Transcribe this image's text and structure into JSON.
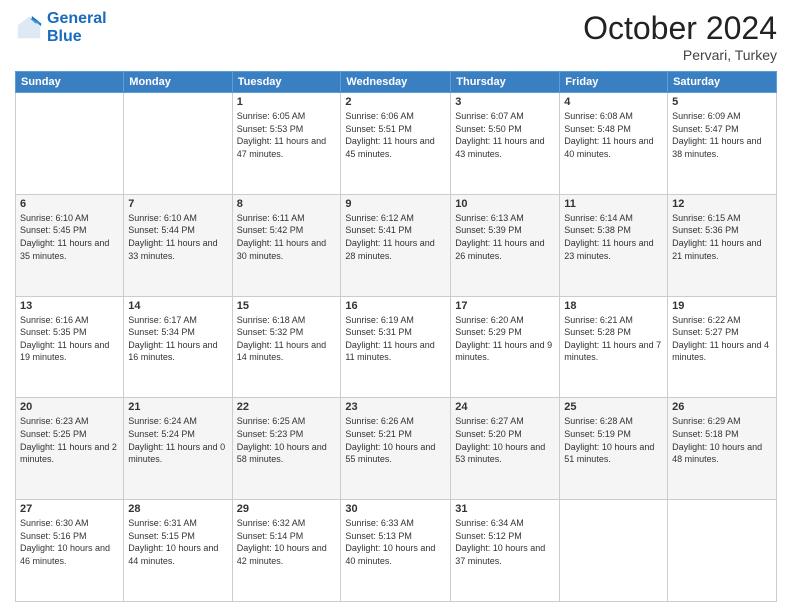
{
  "header": {
    "logo_line1": "General",
    "logo_line2": "Blue",
    "month": "October 2024",
    "location": "Pervari, Turkey"
  },
  "weekdays": [
    "Sunday",
    "Monday",
    "Tuesday",
    "Wednesday",
    "Thursday",
    "Friday",
    "Saturday"
  ],
  "weeks": [
    [
      {
        "day": "",
        "sunrise": "",
        "sunset": "",
        "daylight": ""
      },
      {
        "day": "",
        "sunrise": "",
        "sunset": "",
        "daylight": ""
      },
      {
        "day": "1",
        "sunrise": "Sunrise: 6:05 AM",
        "sunset": "Sunset: 5:53 PM",
        "daylight": "Daylight: 11 hours and 47 minutes."
      },
      {
        "day": "2",
        "sunrise": "Sunrise: 6:06 AM",
        "sunset": "Sunset: 5:51 PM",
        "daylight": "Daylight: 11 hours and 45 minutes."
      },
      {
        "day": "3",
        "sunrise": "Sunrise: 6:07 AM",
        "sunset": "Sunset: 5:50 PM",
        "daylight": "Daylight: 11 hours and 43 minutes."
      },
      {
        "day": "4",
        "sunrise": "Sunrise: 6:08 AM",
        "sunset": "Sunset: 5:48 PM",
        "daylight": "Daylight: 11 hours and 40 minutes."
      },
      {
        "day": "5",
        "sunrise": "Sunrise: 6:09 AM",
        "sunset": "Sunset: 5:47 PM",
        "daylight": "Daylight: 11 hours and 38 minutes."
      }
    ],
    [
      {
        "day": "6",
        "sunrise": "Sunrise: 6:10 AM",
        "sunset": "Sunset: 5:45 PM",
        "daylight": "Daylight: 11 hours and 35 minutes."
      },
      {
        "day": "7",
        "sunrise": "Sunrise: 6:10 AM",
        "sunset": "Sunset: 5:44 PM",
        "daylight": "Daylight: 11 hours and 33 minutes."
      },
      {
        "day": "8",
        "sunrise": "Sunrise: 6:11 AM",
        "sunset": "Sunset: 5:42 PM",
        "daylight": "Daylight: 11 hours and 30 minutes."
      },
      {
        "day": "9",
        "sunrise": "Sunrise: 6:12 AM",
        "sunset": "Sunset: 5:41 PM",
        "daylight": "Daylight: 11 hours and 28 minutes."
      },
      {
        "day": "10",
        "sunrise": "Sunrise: 6:13 AM",
        "sunset": "Sunset: 5:39 PM",
        "daylight": "Daylight: 11 hours and 26 minutes."
      },
      {
        "day": "11",
        "sunrise": "Sunrise: 6:14 AM",
        "sunset": "Sunset: 5:38 PM",
        "daylight": "Daylight: 11 hours and 23 minutes."
      },
      {
        "day": "12",
        "sunrise": "Sunrise: 6:15 AM",
        "sunset": "Sunset: 5:36 PM",
        "daylight": "Daylight: 11 hours and 21 minutes."
      }
    ],
    [
      {
        "day": "13",
        "sunrise": "Sunrise: 6:16 AM",
        "sunset": "Sunset: 5:35 PM",
        "daylight": "Daylight: 11 hours and 19 minutes."
      },
      {
        "day": "14",
        "sunrise": "Sunrise: 6:17 AM",
        "sunset": "Sunset: 5:34 PM",
        "daylight": "Daylight: 11 hours and 16 minutes."
      },
      {
        "day": "15",
        "sunrise": "Sunrise: 6:18 AM",
        "sunset": "Sunset: 5:32 PM",
        "daylight": "Daylight: 11 hours and 14 minutes."
      },
      {
        "day": "16",
        "sunrise": "Sunrise: 6:19 AM",
        "sunset": "Sunset: 5:31 PM",
        "daylight": "Daylight: 11 hours and 11 minutes."
      },
      {
        "day": "17",
        "sunrise": "Sunrise: 6:20 AM",
        "sunset": "Sunset: 5:29 PM",
        "daylight": "Daylight: 11 hours and 9 minutes."
      },
      {
        "day": "18",
        "sunrise": "Sunrise: 6:21 AM",
        "sunset": "Sunset: 5:28 PM",
        "daylight": "Daylight: 11 hours and 7 minutes."
      },
      {
        "day": "19",
        "sunrise": "Sunrise: 6:22 AM",
        "sunset": "Sunset: 5:27 PM",
        "daylight": "Daylight: 11 hours and 4 minutes."
      }
    ],
    [
      {
        "day": "20",
        "sunrise": "Sunrise: 6:23 AM",
        "sunset": "Sunset: 5:25 PM",
        "daylight": "Daylight: 11 hours and 2 minutes."
      },
      {
        "day": "21",
        "sunrise": "Sunrise: 6:24 AM",
        "sunset": "Sunset: 5:24 PM",
        "daylight": "Daylight: 11 hours and 0 minutes."
      },
      {
        "day": "22",
        "sunrise": "Sunrise: 6:25 AM",
        "sunset": "Sunset: 5:23 PM",
        "daylight": "Daylight: 10 hours and 58 minutes."
      },
      {
        "day": "23",
        "sunrise": "Sunrise: 6:26 AM",
        "sunset": "Sunset: 5:21 PM",
        "daylight": "Daylight: 10 hours and 55 minutes."
      },
      {
        "day": "24",
        "sunrise": "Sunrise: 6:27 AM",
        "sunset": "Sunset: 5:20 PM",
        "daylight": "Daylight: 10 hours and 53 minutes."
      },
      {
        "day": "25",
        "sunrise": "Sunrise: 6:28 AM",
        "sunset": "Sunset: 5:19 PM",
        "daylight": "Daylight: 10 hours and 51 minutes."
      },
      {
        "day": "26",
        "sunrise": "Sunrise: 6:29 AM",
        "sunset": "Sunset: 5:18 PM",
        "daylight": "Daylight: 10 hours and 48 minutes."
      }
    ],
    [
      {
        "day": "27",
        "sunrise": "Sunrise: 6:30 AM",
        "sunset": "Sunset: 5:16 PM",
        "daylight": "Daylight: 10 hours and 46 minutes."
      },
      {
        "day": "28",
        "sunrise": "Sunrise: 6:31 AM",
        "sunset": "Sunset: 5:15 PM",
        "daylight": "Daylight: 10 hours and 44 minutes."
      },
      {
        "day": "29",
        "sunrise": "Sunrise: 6:32 AM",
        "sunset": "Sunset: 5:14 PM",
        "daylight": "Daylight: 10 hours and 42 minutes."
      },
      {
        "day": "30",
        "sunrise": "Sunrise: 6:33 AM",
        "sunset": "Sunset: 5:13 PM",
        "daylight": "Daylight: 10 hours and 40 minutes."
      },
      {
        "day": "31",
        "sunrise": "Sunrise: 6:34 AM",
        "sunset": "Sunset: 5:12 PM",
        "daylight": "Daylight: 10 hours and 37 minutes."
      },
      {
        "day": "",
        "sunrise": "",
        "sunset": "",
        "daylight": ""
      },
      {
        "day": "",
        "sunrise": "",
        "sunset": "",
        "daylight": ""
      }
    ]
  ]
}
